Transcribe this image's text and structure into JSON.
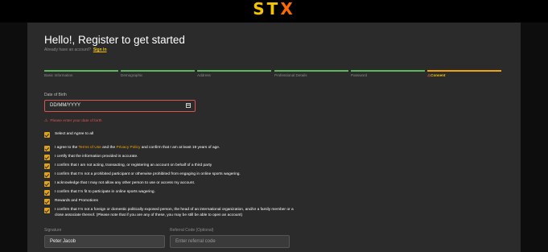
{
  "header": {
    "logo_st": "ST",
    "logo_x": "X"
  },
  "form": {
    "title": "Hello!, Register to get started",
    "subtitle": "Already have an account?",
    "signin_label": "Sign In"
  },
  "steps": [
    {
      "label": "Basic Information",
      "state": "complete"
    },
    {
      "label": "Demographic",
      "state": "complete"
    },
    {
      "label": "Address",
      "state": "complete"
    },
    {
      "label": "Professional Details",
      "state": "complete"
    },
    {
      "label": "Password",
      "state": "complete"
    },
    {
      "label": "Consent",
      "state": "active"
    }
  ],
  "dob": {
    "label": "Date of Birth",
    "value": "DD/MM/YYYY",
    "error": "Please enter your date of birth"
  },
  "checkboxes": {
    "select_all": "Select and Agree to all",
    "terms_pre": "I agree to the",
    "terms_link": "Terms of Use",
    "terms_and": "and the",
    "privacy_link": "Privacy Policy",
    "terms_post": "and confirm that I am at least 19 years of age.",
    "items": [
      "I certify that the information provided is accurate.",
      "I confirm that I am not acting, transacting, or registering an account on behalf of a third party",
      "I confirm that I'm not a prohibited participant or otherwise prohibited from engaging in online sports wagering.",
      "I acknowledge that I may not allow any other person to use or access my account.",
      "I confirm that I'm fit to participate in online sports wagering.",
      "Rewards and Promotions",
      "I confirm that I'm not a foreign or domestic politically exposed person, the head of an international organization, and/or a family member or a close associate thereof. (Please note that if you are any of these, you may be still be able to open an account)"
    ]
  },
  "signature": {
    "label": "Signature",
    "value": "Peter Jacob"
  },
  "referral": {
    "label": "Referral Code (Optional)",
    "placeholder": "Enter referral code"
  },
  "colors": {
    "accent": "#f5c400",
    "progress": "#5cb85c",
    "error": "#d9534f"
  }
}
